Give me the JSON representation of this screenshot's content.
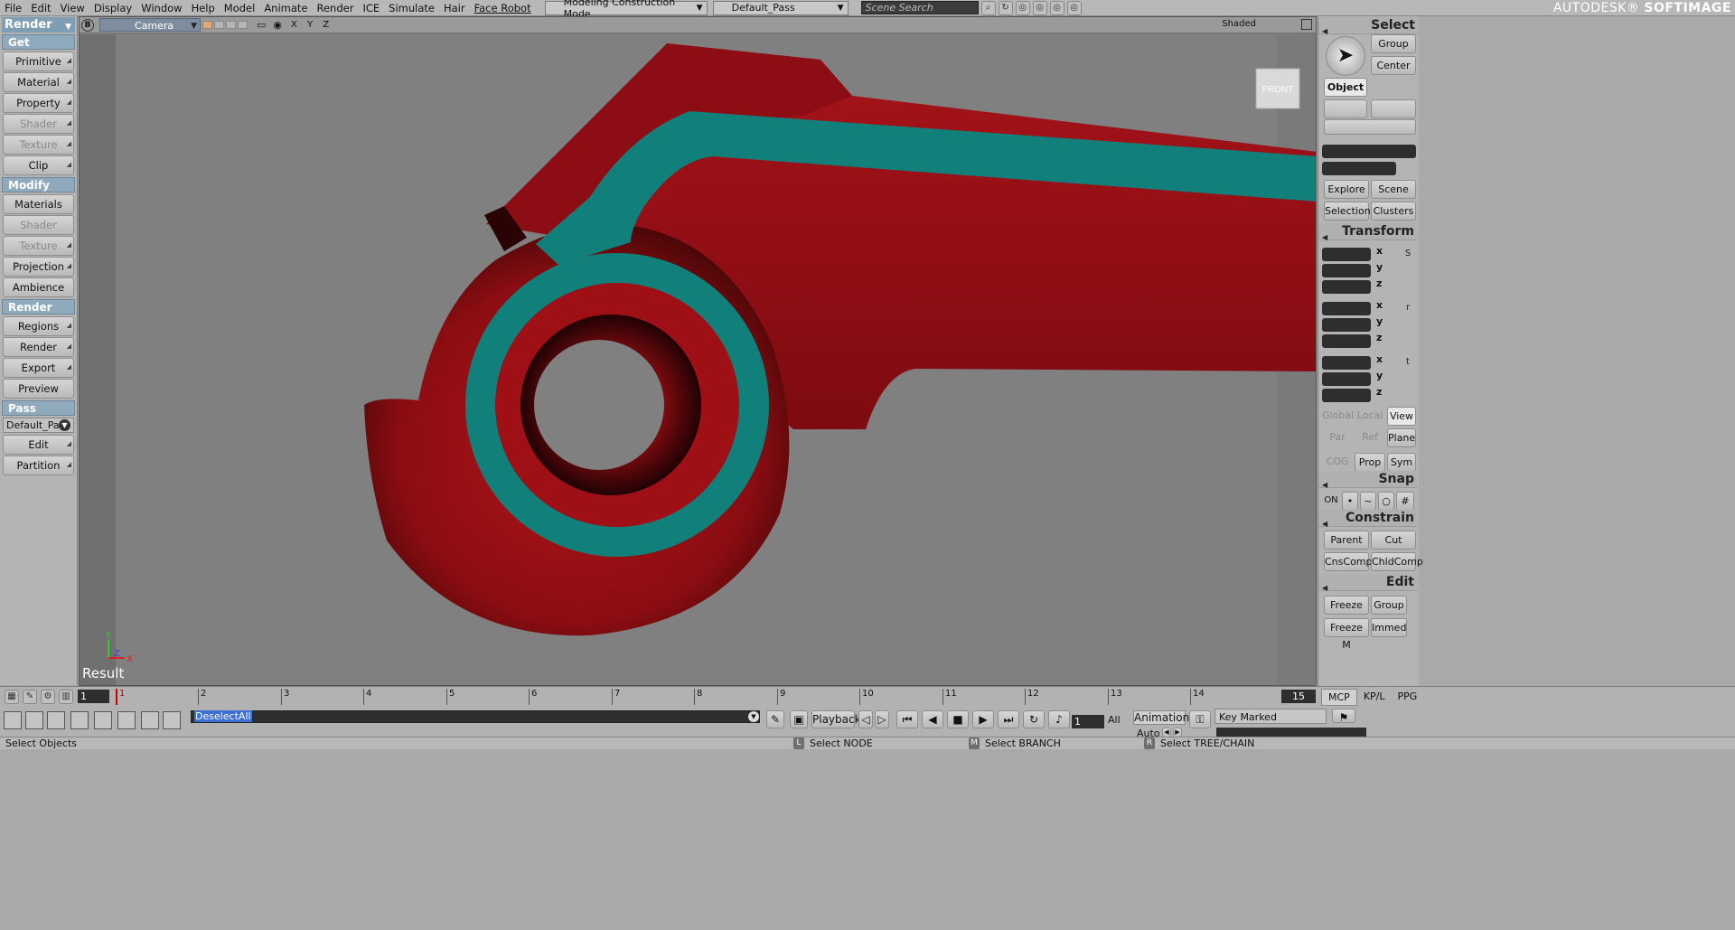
{
  "menubar": {
    "items": [
      "File",
      "Edit",
      "View",
      "Display",
      "Window",
      "Help",
      "Model",
      "Animate",
      "Render",
      "ICE",
      "Simulate",
      "Hair",
      "Face Robot"
    ],
    "mode": "Modeling Construction Mode",
    "pass": "Default_Pass",
    "search_placeholder": "Scene Search",
    "brand_prefix": "AUTODESK®",
    "brand_name": "SOFTIMAGE"
  },
  "left_panel": {
    "module": "Render",
    "sections": [
      {
        "header": "Get",
        "buttons": [
          {
            "label": "Primitive",
            "enabled": true
          },
          {
            "label": "Material",
            "enabled": true
          },
          {
            "label": "Property",
            "enabled": true
          },
          {
            "label": "Shader",
            "enabled": false
          },
          {
            "label": "Texture",
            "enabled": false
          },
          {
            "label": "Clip",
            "enabled": true
          }
        ]
      },
      {
        "header": "Modify",
        "buttons": [
          {
            "label": "Materials",
            "enabled": true
          },
          {
            "label": "Shader",
            "enabled": false
          },
          {
            "label": "Texture",
            "enabled": false
          },
          {
            "label": "Projection",
            "enabled": true
          },
          {
            "label": "Ambience",
            "enabled": true
          }
        ]
      },
      {
        "header": "Render",
        "buttons": [
          {
            "label": "Regions",
            "enabled": true
          },
          {
            "label": "Render",
            "enabled": true
          },
          {
            "label": "Export",
            "enabled": true
          },
          {
            "label": "Preview",
            "enabled": true
          }
        ]
      }
    ],
    "pass_header": "Pass",
    "pass_value": "Default_Pas",
    "pass_buttons": [
      "Edit",
      "Partition"
    ]
  },
  "viewport": {
    "letter": "B",
    "camera": "Camera",
    "axes_label": "X Y Z",
    "shading": "Shaded",
    "view_cube": "FRONT",
    "result_label": "Result",
    "mini_axes": {
      "y": "Y",
      "z": "Z",
      "x": "X"
    }
  },
  "right_panel": {
    "select_header": "Select",
    "group": "Group",
    "center": "Center",
    "object": "Object",
    "explore": "Explore",
    "scene": "Scene",
    "selection": "Selection",
    "clusters": "Clusters",
    "transform_header": "Transform",
    "axes": [
      "x",
      "y",
      "z"
    ],
    "transform_icons": [
      "S",
      "r",
      "t"
    ],
    "global": "Global",
    "local": "Local",
    "view": "View",
    "par": "Par",
    "ref": "Ref",
    "plane": "Plane",
    "cog": "COG",
    "prop": "Prop",
    "sym": "Sym",
    "snap_header": "Snap",
    "snap_on": "ON",
    "constrain_header": "Constrain",
    "parent": "Parent",
    "cut": "Cut",
    "cnscomp": "CnsComp",
    "chldcomp": "ChldComp",
    "edit_header": "Edit",
    "freeze": "Freeze",
    "group2": "Group",
    "freeze_m": "Freeze M",
    "immed": "Immed"
  },
  "timeline": {
    "current_frame": "1",
    "ticks": [
      "1",
      "2",
      "3",
      "4",
      "5",
      "6",
      "7",
      "8",
      "9",
      "10",
      "11",
      "12",
      "13",
      "14"
    ],
    "end_frame": "15",
    "tabs": [
      "MCP",
      "KP/L",
      "PPG"
    ]
  },
  "command_bar": {
    "command": "DeselectAll",
    "playback": "Playback",
    "frame": "1",
    "all": "All",
    "animation": "Animation",
    "auto": "Auto",
    "key_marked": "Key Marked Parameters"
  },
  "status": {
    "message": "Select Objects",
    "l_key": "L",
    "l_text": "Select NODE",
    "m_key": "M",
    "m_text": "Select BRANCH",
    "r_key": "R",
    "r_text": "Select TREE/CHAIN"
  },
  "colors": {
    "model_red": "#9a0f14",
    "model_teal": "#12807a",
    "viewport_bg": "#808080"
  }
}
